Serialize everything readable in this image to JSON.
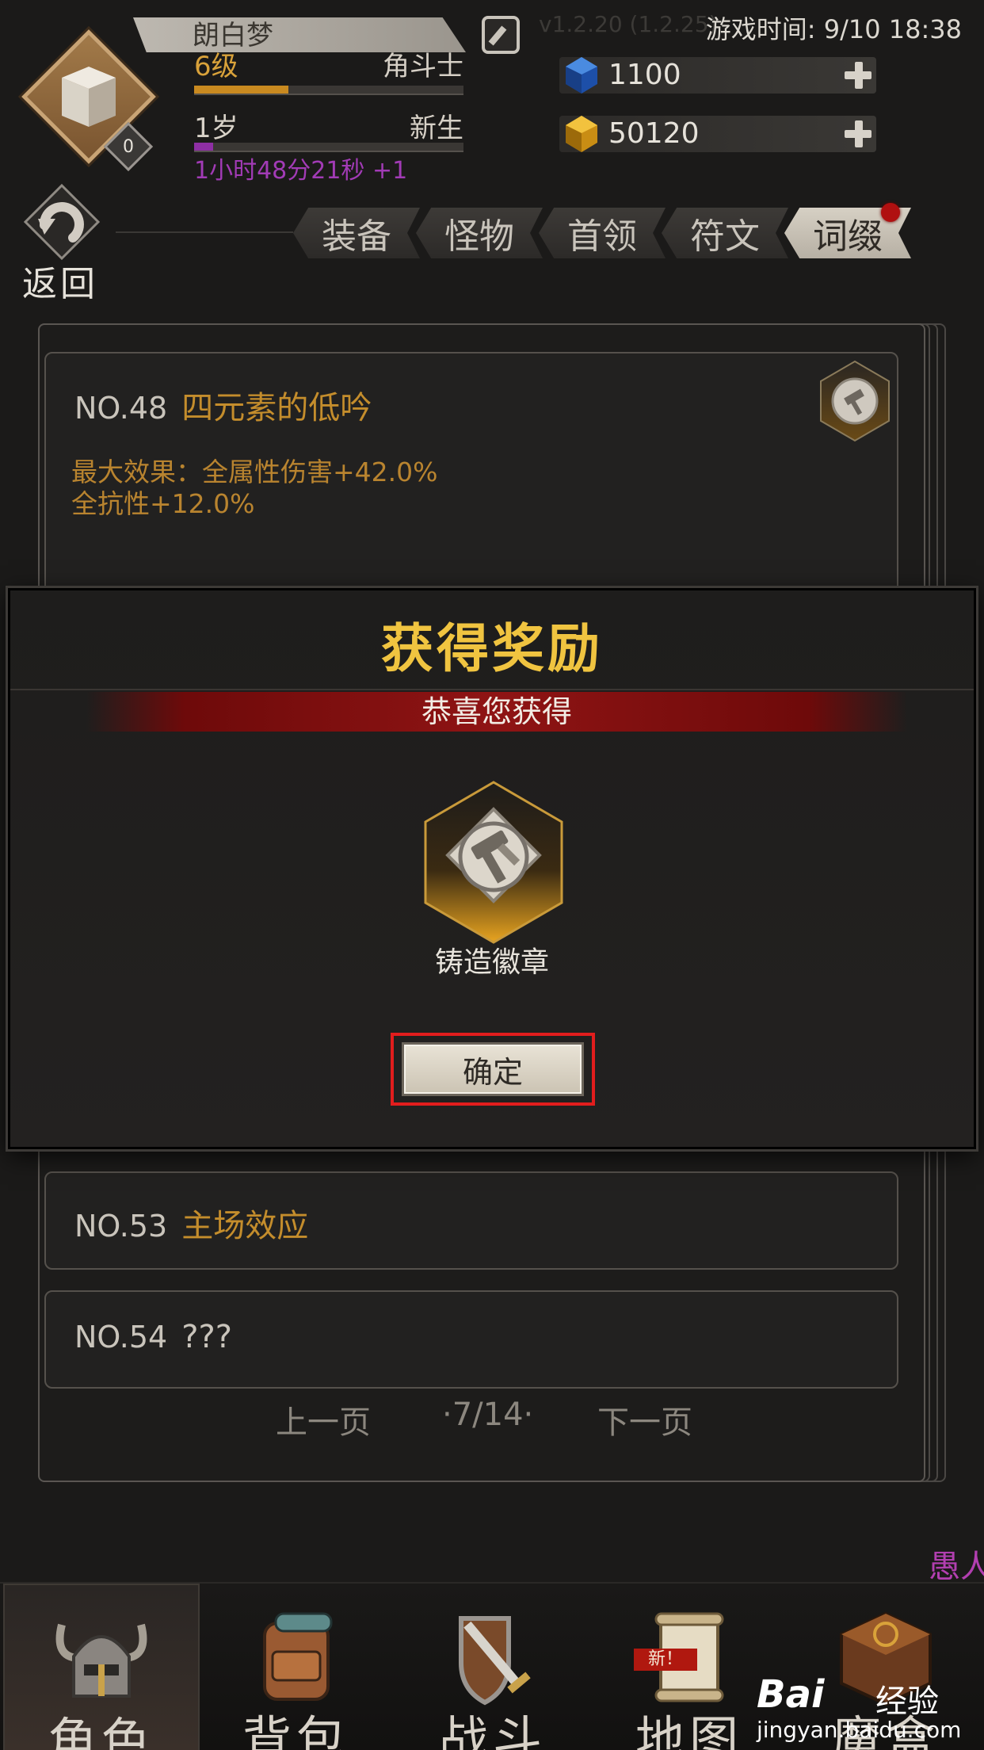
{
  "header": {
    "player_name": "朗白梦",
    "level_text": "6级",
    "class_text": "角斗士",
    "age_text": "1岁",
    "age_status": "新生",
    "timer_text": "1小时48分21秒 +1",
    "avatar_badge": "0",
    "version_text": "v1.2.20 (1.2.25)",
    "game_time": "游戏时间: 9/10 18:38",
    "level_progress": 0.35,
    "age_progress": 0.07
  },
  "resources": [
    {
      "icon": "blue-gem-icon",
      "value": "1100"
    },
    {
      "icon": "gold-gem-icon",
      "value": "50120"
    }
  ],
  "nav": {
    "back_label": "返回",
    "tabs": [
      {
        "label": "装备",
        "active": false
      },
      {
        "label": "怪物",
        "active": false
      },
      {
        "label": "首领",
        "active": false
      },
      {
        "label": "符文",
        "active": false
      },
      {
        "label": "词缀",
        "active": true
      }
    ]
  },
  "entries": [
    {
      "no": "NO.48",
      "title": "四元素的低吟",
      "effect_line1": "最大效果：全属性伤害+42.0%",
      "effect_line2": "全抗性+12.0%"
    },
    {
      "no": "NO.53",
      "title": "主场效应"
    },
    {
      "no": "NO.54",
      "title": "???"
    }
  ],
  "pager": {
    "prev": "上一页",
    "page": "·7/14·",
    "next": "下一页"
  },
  "modal": {
    "title": "获得奖励",
    "subtitle": "恭喜您获得",
    "reward_name": "铸造徽章",
    "confirm_label": "确定"
  },
  "side_text": "愚人",
  "bottom_nav": [
    {
      "label": "角色",
      "active": true
    },
    {
      "label": "背包",
      "active": false
    },
    {
      "label": "战斗",
      "active": false
    },
    {
      "label": "地图",
      "active": false
    },
    {
      "label": "魔盒",
      "active": false
    }
  ],
  "new_tag": "新！",
  "watermark": {
    "brand": "Bai",
    "suffix": "经验",
    "url": "jingyan.baidu.com"
  },
  "colors": {
    "accent_gold": "#f0c440",
    "entry_title": "#c48d2c",
    "timer_purple": "#a23bb6",
    "highlight_red": "#e21d1d",
    "level_bar": "#c98a20",
    "age_bar": "#8e2fa4"
  }
}
